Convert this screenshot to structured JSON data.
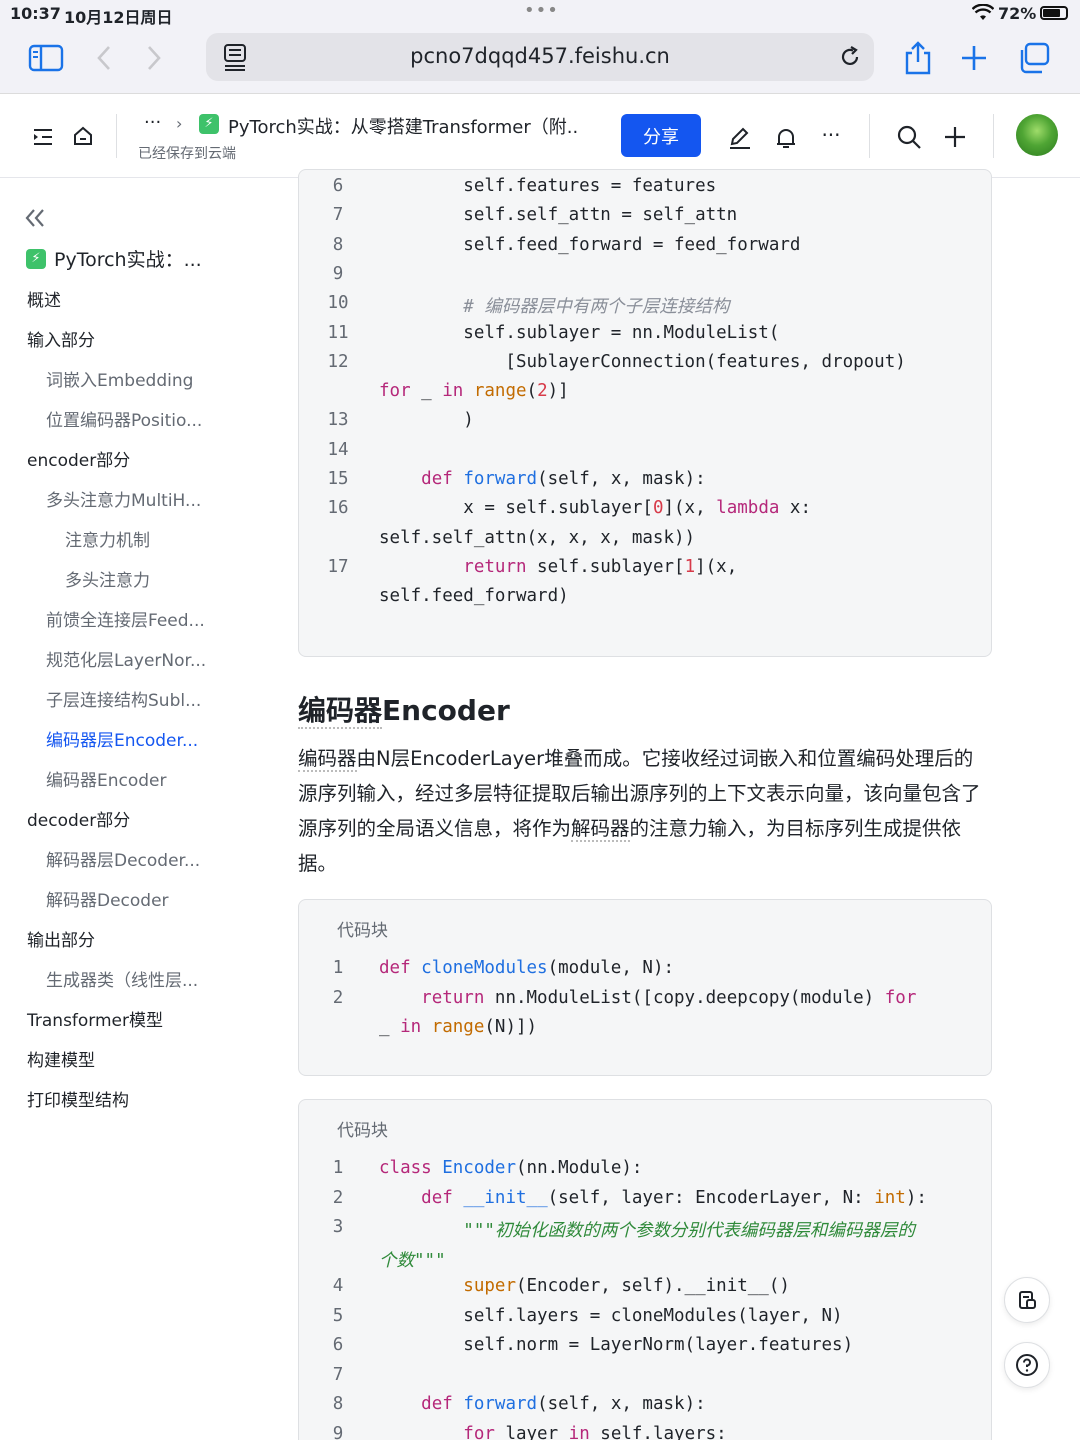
{
  "status": {
    "time": "10:37",
    "date": "10月12日周日",
    "dots": "•••",
    "battery": "72%"
  },
  "browser": {
    "url": "pcno7dqqd457.feishu.cn"
  },
  "header": {
    "breadcrumb_ellipsis": "···",
    "doc_title": "PyTorch实战：从零搭建Transformer（附...",
    "saved": "已经保存到云端",
    "share": "分享",
    "more": "···"
  },
  "sidebar": {
    "doc_label": "PyTorch实战：...",
    "items": [
      {
        "label": "概述",
        "level": 1
      },
      {
        "label": "输入部分",
        "level": 1
      },
      {
        "label": "词嵌入Embedding",
        "level": 2
      },
      {
        "label": "位置编码器Positio...",
        "level": 2
      },
      {
        "label": "encoder部分",
        "level": 1
      },
      {
        "label": "多头注意力MultiH...",
        "level": 2
      },
      {
        "label": "注意力机制",
        "level": 3
      },
      {
        "label": "多头注意力",
        "level": 3
      },
      {
        "label": "前馈全连接层Feed...",
        "level": 2
      },
      {
        "label": "规范化层LayerNor...",
        "level": 2
      },
      {
        "label": "子层连接结构Subl...",
        "level": 2
      },
      {
        "label": "编码器层Encoder...",
        "level": 2,
        "active": true
      },
      {
        "label": "编码器Encoder",
        "level": 2
      },
      {
        "label": "decoder部分",
        "level": 1
      },
      {
        "label": "解码器层Decoder...",
        "level": 2
      },
      {
        "label": "解码器Decoder",
        "level": 2
      },
      {
        "label": "输出部分",
        "level": 1
      },
      {
        "label": "生成器类（线性层...",
        "level": 2
      },
      {
        "label": "Transformer模型",
        "level": 1
      },
      {
        "label": "构建模型",
        "level": 1
      },
      {
        "label": "打印模型结构",
        "level": 1
      }
    ]
  },
  "code1": {
    "lines": [
      {
        "n": "6",
        "t": "        self.features = features"
      },
      {
        "n": "7",
        "t": "        self.self_attn = self_attn"
      },
      {
        "n": "8",
        "t": "        self.feed_forward = feed_forward"
      },
      {
        "n": "9",
        "t": ""
      },
      {
        "n": "10",
        "t": "        # 编码器层中有两个子层连接结构"
      },
      {
        "n": "11",
        "t": "        self.sublayer = nn.ModuleList("
      },
      {
        "n": "12",
        "t": "            [SublayerConnection(features, dropout)"
      },
      {
        "n": "",
        "t": "for _ in range(2)]"
      },
      {
        "n": "13",
        "t": "        )"
      },
      {
        "n": "14",
        "t": ""
      },
      {
        "n": "15",
        "t": "    def forward(self, x, mask):"
      },
      {
        "n": "16",
        "t": "        x = self.sublayer[0](x, lambda x:"
      },
      {
        "n": "",
        "t": "self.self_attn(x, x, x, mask))"
      },
      {
        "n": "17",
        "t": "        return self.sublayer[1](x,"
      },
      {
        "n": "",
        "t": "self.feed_forward)"
      }
    ]
  },
  "section": {
    "title_a": "编码器",
    "title_b": "Encoder",
    "para_a": "编码器",
    "para_b": "由N层EncoderLayer堆叠而成。它接收经过词嵌入和位置编码处理后的源序列输入，经过多层特征提取后输出源序列的上下文表示向量，该向量包含了源序列的全局语义信息，将作为",
    "para_c": "解码器",
    "para_d": "的注意力输入，为目标序列生成提供依据。"
  },
  "code2": {
    "title": "代码块",
    "lines": [
      {
        "n": "1",
        "t": "def cloneModules(module, N):"
      },
      {
        "n": "2",
        "t": "    return nn.ModuleList([copy.deepcopy(module) for"
      },
      {
        "n": "",
        "t": "_ in range(N)])"
      }
    ]
  },
  "code3": {
    "title": "代码块",
    "lines": [
      {
        "n": "1",
        "t": "class Encoder(nn.Module):"
      },
      {
        "n": "2",
        "t": "    def __init__(self, layer: EncoderLayer, N: int):"
      },
      {
        "n": "3",
        "t": "        \"\"\"初始化函数的两个参数分别代表编码器层和编码器层的"
      },
      {
        "n": "",
        "t": "个数\"\"\""
      },
      {
        "n": "4",
        "t": "        super(Encoder, self).__init__()"
      },
      {
        "n": "5",
        "t": "        self.layers = cloneModules(layer, N)"
      },
      {
        "n": "6",
        "t": "        self.norm = LayerNorm(layer.features)"
      },
      {
        "n": "7",
        "t": ""
      },
      {
        "n": "8",
        "t": "    def forward(self, x, mask):"
      },
      {
        "n": "9",
        "t": "        for layer in self.layers:"
      }
    ]
  }
}
